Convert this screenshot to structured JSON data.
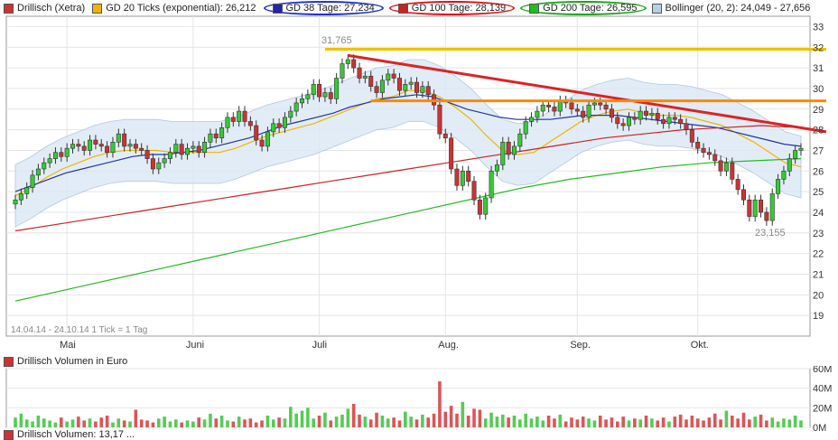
{
  "legend": {
    "items": [
      {
        "label": "Drillisch (Xetra)",
        "color": "#cc3333"
      },
      {
        "label": "GD 20 Ticks (exponential): 26,212",
        "color": "#f0b400"
      },
      {
        "label": "GD 38 Tage: 27,234",
        "color": "#2222aa",
        "oval": "#1a33cc"
      },
      {
        "label": "GD 100 Tage: 28,139",
        "color": "#cc2222",
        "oval": "#dd1111"
      },
      {
        "label": "GD 200 Tage: 26,595",
        "color": "#22bb22",
        "oval": "#11aa11"
      },
      {
        "label": "Bollinger (20, 2): 24,049 - 27,656",
        "color": "#b8cde6"
      }
    ]
  },
  "annotations": {
    "high": "31,765",
    "low": "23,155",
    "period": "14.04.14 - 24.10.14   1 Tick = 1 Tag"
  },
  "volume_legend": "Drillisch Volumen in Euro",
  "bottom_legend": "Drillisch Volumen: 13,17 ...",
  "chart_data": [
    {
      "type": "line",
      "title": "Drillisch (Xetra)",
      "x_labels": [
        "Mai",
        "Juni",
        "Juli",
        "Aug.",
        "Sep.",
        "Okt."
      ],
      "y_ticks": [
        19,
        20,
        21,
        22,
        23,
        24,
        25,
        26,
        27,
        28,
        29,
        30,
        31,
        32,
        33
      ],
      "ylim": [
        18,
        33.5
      ],
      "x_range": [
        0,
        137
      ],
      "grid": true,
      "close": [
        24.6,
        24.9,
        25.2,
        25.8,
        26.1,
        26.4,
        26.6,
        26.9,
        26.7,
        27.1,
        27.3,
        27.2,
        27.0,
        27.5,
        27.3,
        27.2,
        26.9,
        27.4,
        27.8,
        27.2,
        27.3,
        27.1,
        27.0,
        26.6,
        26.1,
        26.4,
        26.6,
        26.9,
        27.3,
        26.8,
        27.1,
        27.2,
        26.9,
        27.4,
        27.8,
        27.6,
        28.1,
        28.6,
        28.4,
        28.9,
        28.4,
        28.2,
        27.5,
        27.2,
        27.9,
        28.3,
        28.1,
        28.6,
        28.9,
        29.3,
        29.5,
        29.7,
        30.2,
        29.6,
        29.8,
        29.5,
        30.5,
        31.2,
        31.4,
        31.0,
        30.5,
        30.6,
        30.1,
        29.8,
        30.4,
        30.7,
        30.5,
        29.9,
        30.2,
        30.3,
        29.8,
        30.1,
        29.7,
        29.2,
        27.8,
        27.6,
        26.1,
        25.3,
        26.0,
        25.5,
        24.6,
        23.9,
        24.7,
        26.0,
        26.3,
        27.4,
        26.8,
        27.2,
        27.8,
        28.4,
        28.6,
        28.9,
        29.2,
        29.1,
        28.9,
        29.4,
        29.3,
        29.0,
        28.9,
        28.6,
        29.2,
        29.3,
        29.2,
        29.0,
        28.6,
        28.3,
        28.2,
        28.6,
        28.5,
        28.9,
        28.7,
        28.8,
        28.5,
        28.3,
        28.6,
        28.5,
        28.3,
        28.0,
        27.4,
        27.1,
        26.9,
        26.8,
        26.5,
        26.0,
        26.4,
        25.6,
        25.1,
        24.6,
        23.8,
        24.6,
        24.0,
        23.6,
        24.9,
        25.6,
        26.0,
        26.6,
        27.0,
        27.1
      ],
      "series": [
        {
          "name": "GD 20 Ticks (exponential)",
          "values": [
            24.8,
            25.2,
            25.7,
            26.1,
            26.4,
            26.7,
            26.9,
            27.0,
            27.0,
            27.0,
            26.9,
            26.9,
            26.9,
            26.9,
            27.1,
            27.4,
            27.7,
            27.9,
            28.1,
            28.3,
            28.6,
            28.9,
            29.2,
            29.5,
            29.6,
            29.9,
            29.9,
            29.6,
            29.1,
            28.5,
            27.7,
            27.0,
            26.8,
            26.9,
            27.4,
            27.9,
            28.4,
            28.7,
            28.9,
            29.0,
            28.8,
            28.7,
            28.7,
            28.6,
            28.4,
            28.2,
            27.8,
            27.4,
            26.9,
            26.4,
            26.2
          ]
        },
        {
          "name": "GD 38 Tage",
          "values": [
            25.0,
            25.3,
            25.6,
            25.9,
            26.1,
            26.3,
            26.5,
            26.7,
            26.8,
            26.8,
            26.9,
            27.0,
            27.2,
            27.4,
            27.6,
            27.9,
            28.2,
            28.4,
            28.6,
            28.8,
            29.1,
            29.3,
            29.5,
            29.6,
            29.7,
            29.6,
            29.3,
            29.0,
            28.8,
            28.6,
            28.5,
            28.5,
            28.5,
            28.6,
            28.7,
            28.7,
            28.7,
            28.6,
            28.5,
            28.4,
            28.3,
            28.2,
            28.1,
            27.9,
            27.7,
            27.5,
            27.3,
            27.2
          ]
        },
        {
          "name": "GD 100 Tage",
          "values": [
            23.1,
            23.4,
            23.7,
            24.0,
            24.3,
            24.6,
            24.9,
            25.2,
            25.5,
            25.8,
            26.1,
            26.4,
            26.7,
            27.0,
            27.3,
            27.6,
            27.8,
            28.0,
            28.1,
            28.2,
            28.1
          ]
        },
        {
          "name": "GD 200 Tage",
          "values": [
            19.7,
            20.2,
            20.7,
            21.2,
            21.7,
            22.2,
            22.7,
            23.2,
            23.7,
            24.2,
            24.7,
            25.2,
            25.6,
            25.9,
            26.2,
            26.4,
            26.5,
            26.6
          ]
        }
      ],
      "trendlines": [
        {
          "name": "downtrend",
          "color": "#dd2222",
          "points": [
            [
              58,
              31.6
            ],
            [
              137,
              27.9
            ]
          ]
        },
        {
          "name": "resistance-high",
          "color": "#f0c000",
          "points": [
            [
              54,
              31.9
            ],
            [
              137,
              31.9
            ]
          ]
        },
        {
          "name": "resistance-mid",
          "color": "#ff8800",
          "points": [
            [
              62,
              29.4
            ],
            [
              137,
              29.4
            ]
          ]
        }
      ]
    },
    {
      "type": "bar",
      "title": "Drillisch Volumen in Euro",
      "y_ticks": [
        "0M",
        "20M",
        "40M",
        "60M"
      ],
      "ylim": [
        0,
        60
      ],
      "values": [
        10,
        14,
        8,
        6,
        12,
        9,
        7,
        5,
        10,
        6,
        8,
        11,
        7,
        9,
        6,
        10,
        12,
        5,
        9,
        7,
        6,
        18,
        8,
        7,
        5,
        9,
        11,
        6,
        8,
        5,
        7,
        6,
        10,
        8,
        14,
        9,
        12,
        7,
        6,
        11,
        8,
        9,
        5,
        7,
        12,
        8,
        10,
        9,
        21,
        14,
        17,
        20,
        9,
        12,
        15,
        7,
        11,
        13,
        19,
        24,
        13,
        11,
        8,
        15,
        12,
        9,
        10,
        7,
        16,
        11,
        8,
        13,
        10,
        14,
        47,
        16,
        22,
        14,
        26,
        12,
        19,
        18,
        9,
        15,
        11,
        13,
        10,
        12,
        8,
        14,
        9,
        11,
        7,
        12,
        9,
        13,
        6,
        10,
        8,
        11,
        9,
        7,
        12,
        8,
        10,
        6,
        11,
        7,
        9,
        8,
        12,
        9,
        7,
        10,
        6,
        11,
        13,
        8,
        12,
        9,
        7,
        10,
        14,
        8,
        17,
        12,
        9,
        15,
        8,
        11,
        13,
        7,
        10,
        6,
        9,
        8,
        12,
        7
      ],
      "colors_rule": "green = close up, red = close down"
    }
  ],
  "colors": {
    "up": "#33cc33",
    "down": "#cc3333",
    "band": "#dce8f5",
    "volume_up": "#55cc55",
    "volume_down": "#dd5555"
  }
}
